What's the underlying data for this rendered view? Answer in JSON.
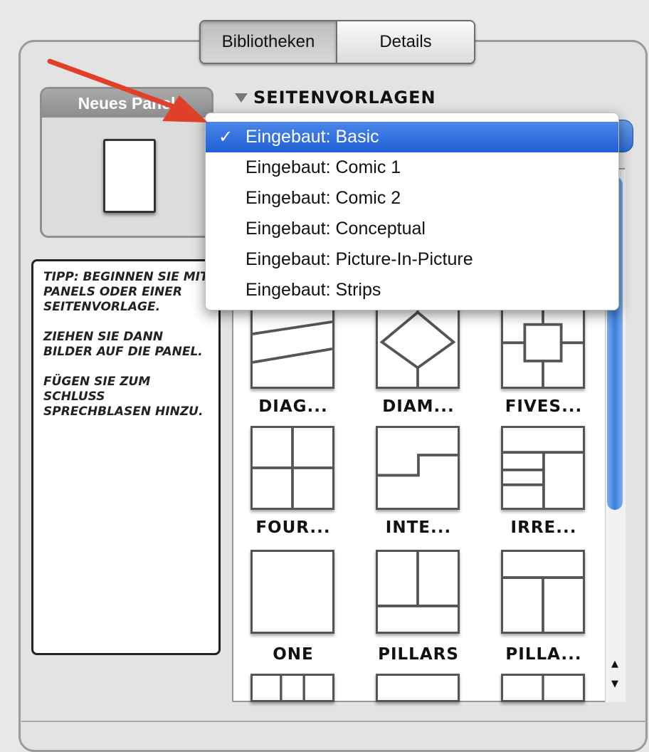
{
  "tabs": {
    "libraries": "Bibliotheken",
    "details": "Details"
  },
  "new_panel": {
    "title": "Neues Panel"
  },
  "tips": {
    "p1": "Tipp: Beginnen Sie mit Panels oder einer Seitenvorlage.",
    "p2": "Ziehen Sie dann Bilder auf die Panel.",
    "p3": "Fügen Sie zum Schluss Sprechblasen hinzu."
  },
  "section": {
    "title": "SEITENVORLAGEN"
  },
  "dropdown": {
    "checkmark": "✓",
    "items": [
      "Eingebaut: Basic",
      "Eingebaut: Comic 1",
      "Eingebaut: Comic 2",
      "Eingebaut: Conceptual",
      "Eingebaut: Picture-In-Picture",
      "Eingebaut: Strips"
    ],
    "selected_index": 0
  },
  "templates": [
    {
      "label": "DIAG..."
    },
    {
      "label": "DIAM..."
    },
    {
      "label": "FIVES..."
    },
    {
      "label": "FOUR..."
    },
    {
      "label": "INTE..."
    },
    {
      "label": "IRRE..."
    },
    {
      "label": "ONE"
    },
    {
      "label": "PILLARS"
    },
    {
      "label": "PILLA..."
    }
  ],
  "scroll": {
    "up": "▲",
    "down": "▼"
  },
  "colors": {
    "selection": "#2a67d8",
    "arrow": "#e0402a"
  }
}
